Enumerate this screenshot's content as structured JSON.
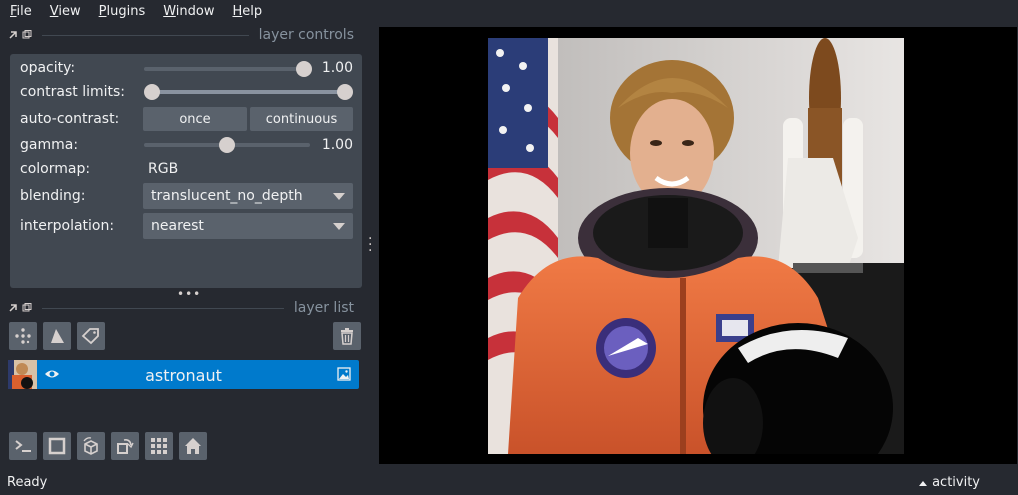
{
  "menu": [
    "File",
    "View",
    "Plugins",
    "Window",
    "Help"
  ],
  "layer_controls": {
    "title": "layer controls",
    "opacity": {
      "label": "opacity:",
      "value": "1.00",
      "fraction": 1.0
    },
    "contrast_limits": {
      "label": "contrast limits:",
      "low": 0.0,
      "high": 1.0
    },
    "auto_contrast": {
      "label": "auto-contrast:",
      "once": "once",
      "continuous": "continuous"
    },
    "gamma": {
      "label": "gamma:",
      "value": "1.00",
      "fraction": 0.5
    },
    "colormap": {
      "label": "colormap:",
      "value": "RGB"
    },
    "blending": {
      "label": "blending:",
      "value": "translucent_no_depth"
    },
    "interpolation": {
      "label": "interpolation:",
      "value": "nearest"
    }
  },
  "layer_list": {
    "title": "layer list",
    "tools": [
      "new-points-icon",
      "new-shapes-icon",
      "new-labels-icon",
      "delete-layer-icon"
    ],
    "layers": [
      {
        "name": "astronaut",
        "visible": true,
        "type": "image-icon"
      }
    ]
  },
  "bottom_toolbar": [
    "console-icon",
    "ndisplay-icon",
    "roll-dims-icon",
    "transpose-icon",
    "grid-icon",
    "home-icon"
  ],
  "status": {
    "text": "Ready",
    "activity": "activity"
  },
  "colors": {
    "background": "#262930",
    "panel": "#414851",
    "control": "#5a626c",
    "selection": "#007acc"
  }
}
